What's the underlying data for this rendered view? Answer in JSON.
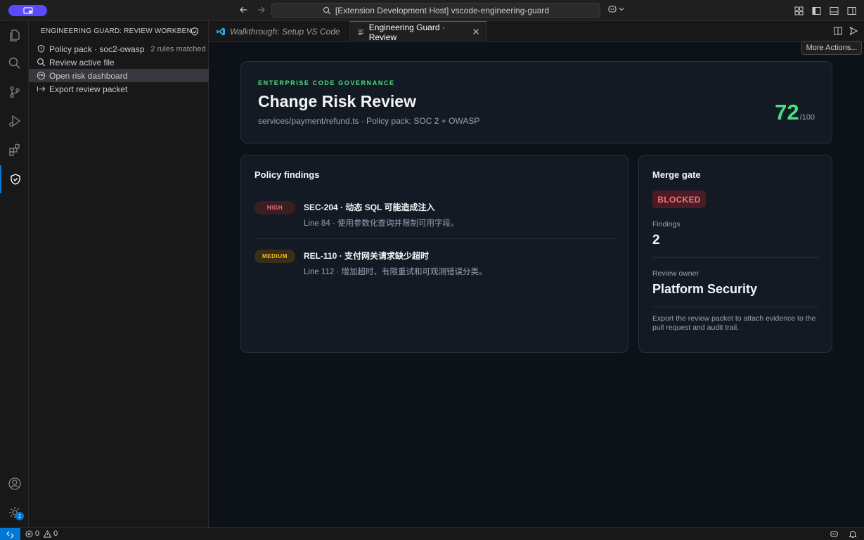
{
  "titlebar": {
    "command_center": "[Extension Development Host] vscode-engineering-guard"
  },
  "sidebar": {
    "header": "ENGINEERING GUARD: REVIEW WORKBEN...",
    "items": [
      {
        "label": "Policy pack · soc2-owasp",
        "description": "2 rules matched",
        "icon": "shield-icon"
      },
      {
        "label": "Review active file",
        "icon": "search-icon"
      },
      {
        "label": "Open risk dashboard",
        "icon": "dashboard-icon"
      },
      {
        "label": "Export review packet",
        "icon": "export-icon"
      }
    ]
  },
  "tabs": [
    {
      "label": "Walkthrough: Setup VS Code",
      "icon": "vscode-icon"
    },
    {
      "label": "Engineering Guard · Review",
      "icon": "preview-icon"
    }
  ],
  "tooltip": "More Actions...",
  "hero": {
    "eyebrow": "ENTERPRISE CODE GOVERNANCE",
    "title": "Change Risk Review",
    "subtitle": "services/payment/refund.ts · Policy pack: SOC 2 + OWASP",
    "score": "72",
    "score_max": "/100"
  },
  "findings": {
    "title": "Policy findings",
    "items": [
      {
        "severity": "HIGH",
        "title": "SEC-204 · 动态 SQL 可能造成注入",
        "desc": "Line 84 · 使用参数化查询并限制可用字段。"
      },
      {
        "severity": "MEDIUM",
        "title": "REL-110 · 支付网关请求缺少超时",
        "desc": "Line 112 · 增加超时、有限重试和可观测错误分类。"
      }
    ]
  },
  "gate": {
    "title": "Merge gate",
    "status": "BLOCKED",
    "findings_label": "Findings",
    "findings_count": "2",
    "owner_label": "Review owner",
    "owner": "Platform Security",
    "note": "Export the review packet to attach evidence to the pull request and audit trail."
  },
  "statusbar": {
    "errors": "0",
    "warnings": "0",
    "settings_badge": "1"
  },
  "colors": {
    "accent": "#0078d4",
    "score": "#4ade80",
    "high": "#f87171",
    "medium": "#fbbf24",
    "window_pill": "#5b4bff"
  }
}
